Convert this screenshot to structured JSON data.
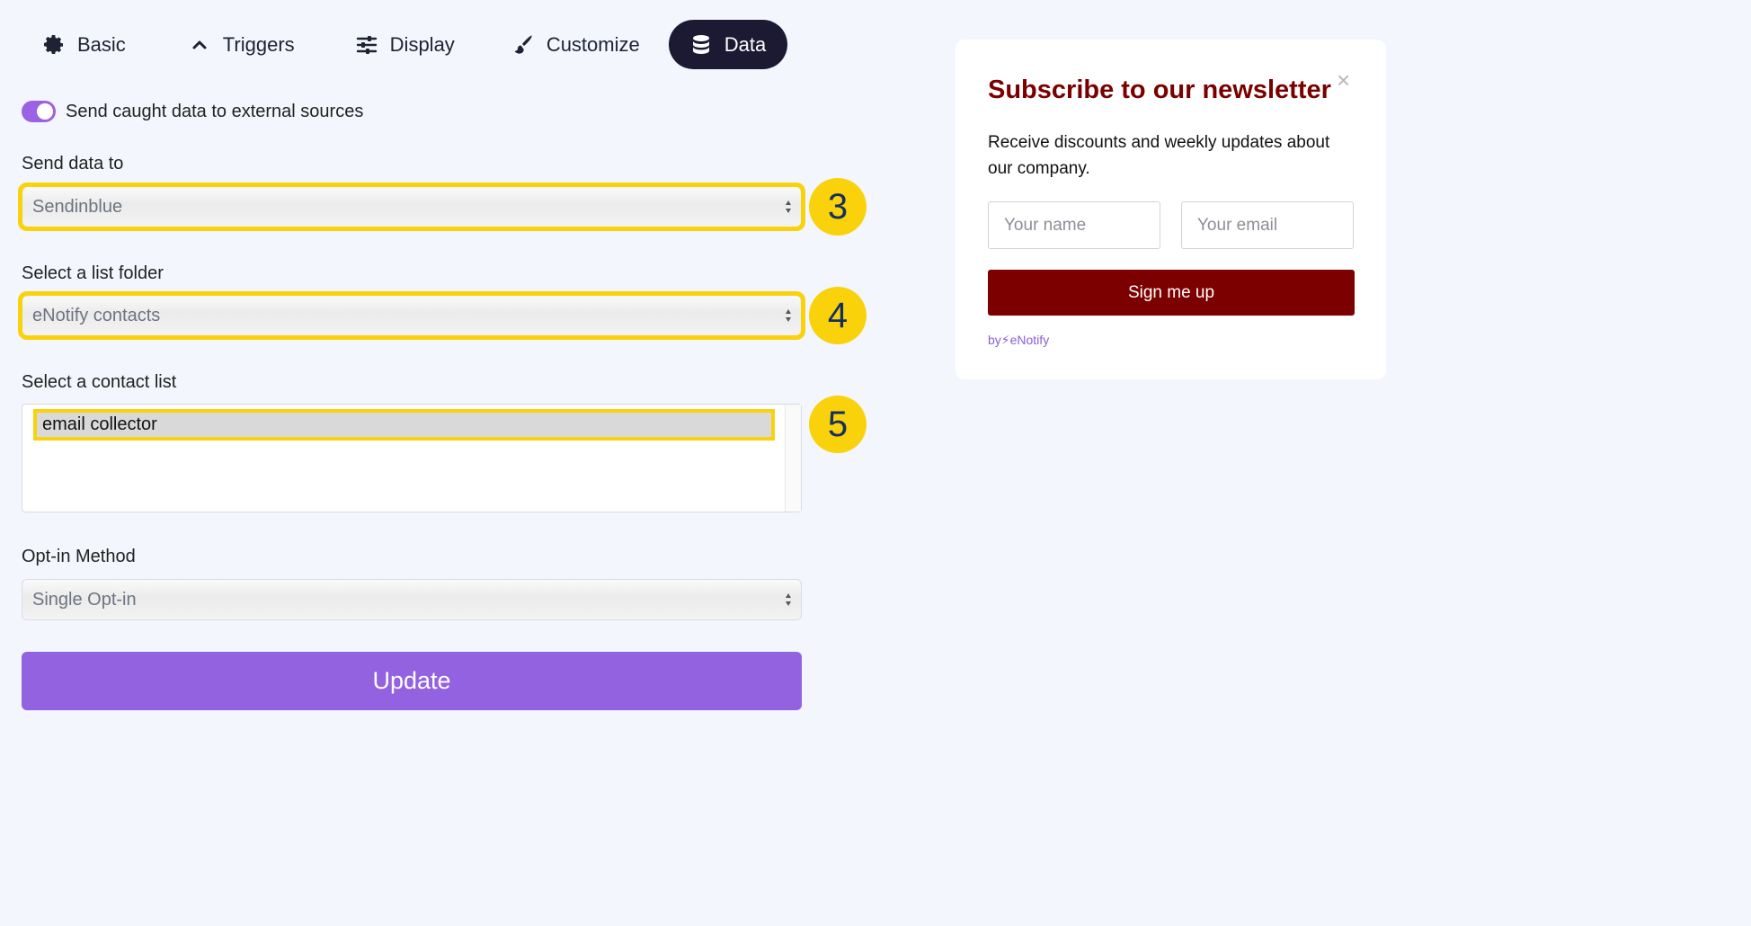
{
  "tabs": [
    {
      "label": "Basic",
      "icon": "gear-icon"
    },
    {
      "label": "Triggers",
      "icon": "chevron-up-icon"
    },
    {
      "label": "Display",
      "icon": "sliders-icon"
    },
    {
      "label": "Customize",
      "icon": "paintbrush-icon"
    },
    {
      "label": "Data",
      "icon": "database-icon",
      "active": true
    }
  ],
  "toggle": {
    "label": "Send caught data to external sources",
    "on": true
  },
  "fields": {
    "send_to": {
      "label": "Send data to",
      "value": "Sendinblue",
      "badge": "3"
    },
    "list_folder": {
      "label": "Select a list folder",
      "value": "eNotify contacts",
      "badge": "4"
    },
    "contact_list": {
      "label": "Select a contact list",
      "selected": "email collector",
      "badge": "5"
    },
    "opt_in": {
      "label": "Opt-in Method",
      "value": "Single Opt-in"
    }
  },
  "update_label": "Update",
  "preview": {
    "title": "Subscribe to our newsletter",
    "close": "×",
    "description": "Receive discounts and weekly updates about our company.",
    "name_placeholder": "Your name",
    "email_placeholder": "Your email",
    "button_label": "Sign me up",
    "by_label": "by⚡eNotify"
  },
  "colors": {
    "accent": "#9262e0",
    "highlight": "#f9d20c",
    "preview_brand": "#7d0000",
    "active_tab": "#1c1a33"
  }
}
